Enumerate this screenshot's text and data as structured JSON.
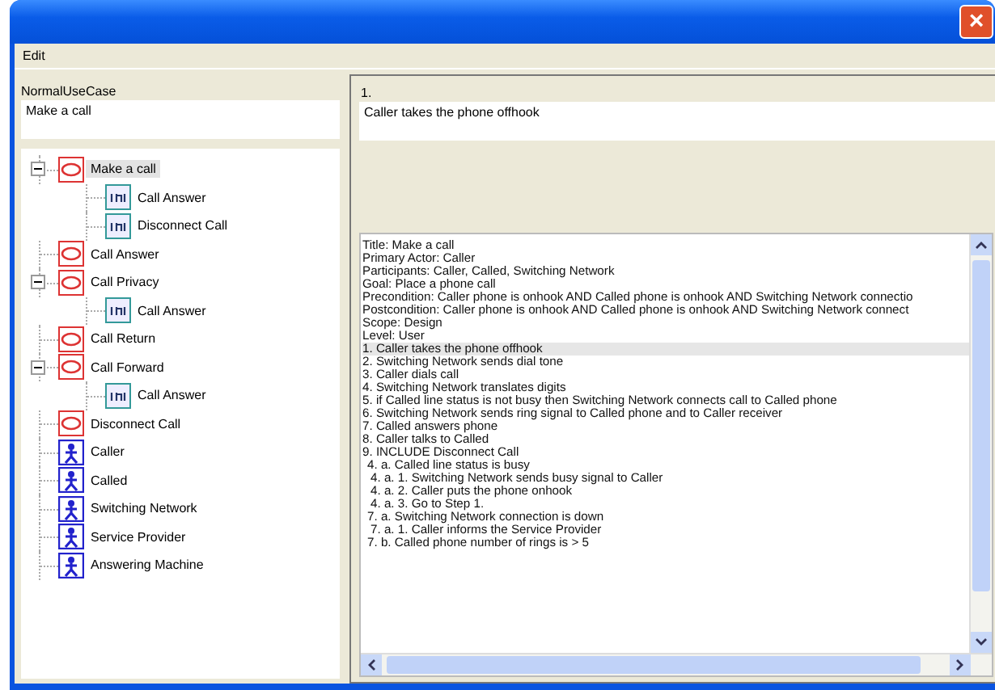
{
  "window": {
    "close": "×"
  },
  "menu": [
    {
      "label": "Edit"
    }
  ],
  "use_case": {
    "label": "NormalUseCase",
    "value": "Make a call"
  },
  "tree": [
    {
      "label": "Make a call",
      "kind": "usecase",
      "selected": true,
      "expanded": true,
      "children": [
        {
          "label": "Call Answer",
          "kind": "include",
          "selected": false
        },
        {
          "label": "Disconnect Call",
          "kind": "include",
          "selected": false
        }
      ]
    },
    {
      "label": "Call Answer",
      "kind": "usecase",
      "selected": false
    },
    {
      "label": "Call Privacy",
      "kind": "usecase",
      "selected": false,
      "expanded": true,
      "children": [
        {
          "label": "Call Answer",
          "kind": "include",
          "selected": false
        }
      ]
    },
    {
      "label": "Call Return",
      "kind": "usecase",
      "selected": false
    },
    {
      "label": "Call Forward",
      "kind": "usecase",
      "selected": false,
      "expanded": true,
      "children": [
        {
          "label": "Call Answer",
          "kind": "include",
          "selected": false
        }
      ]
    },
    {
      "label": "Disconnect Call",
      "kind": "usecase",
      "selected": false
    },
    {
      "label": "Caller",
      "kind": "actor",
      "selected": false
    },
    {
      "label": "Called",
      "kind": "actor",
      "selected": false
    },
    {
      "label": "Switching Network",
      "kind": "actor",
      "selected": false
    },
    {
      "label": "Service Provider",
      "kind": "actor",
      "selected": false
    },
    {
      "label": "Answering Machine",
      "kind": "actor",
      "selected": false
    }
  ],
  "step": {
    "label": "1.",
    "value": "Caller takes the phone offhook"
  },
  "lines": [
    {
      "text": "Title: Make a call",
      "kind": "info",
      "selected": false
    },
    {
      "text": "Primary Actor: Caller",
      "kind": "info",
      "selected": false
    },
    {
      "text": "Participants: Caller, Called, Switching Network",
      "kind": "info",
      "selected": false
    },
    {
      "text": "Goal: Place a phone call",
      "kind": "info",
      "selected": false
    },
    {
      "text": "Precondition: Caller phone is onhook AND Called phone is onhook  AND Switching Network connectio",
      "kind": "info",
      "selected": false
    },
    {
      "text": "Postcondition: Caller phone is onhook AND Called phone is onhook  AND Switching Network connect",
      "kind": "info",
      "selected": false
    },
    {
      "text": "Scope: Design",
      "kind": "info",
      "selected": false
    },
    {
      "text": "Level: User",
      "kind": "info",
      "selected": false
    },
    {
      "text": "1. Caller takes the phone offhook",
      "kind": "step",
      "selected": true
    },
    {
      "text": "2. Switching Network sends dial tone",
      "kind": "step",
      "selected": false
    },
    {
      "text": "3. Caller dials call",
      "kind": "step",
      "selected": false
    },
    {
      "text": "4. Switching Network translates digits",
      "kind": "step",
      "selected": false
    },
    {
      "text": "5. if Called line status is not busy then Switching Network connects call to Called phone",
      "kind": "step",
      "selected": false
    },
    {
      "text": "6. Switching Network sends ring signal to Called phone and to Caller receiver",
      "kind": "step",
      "selected": false
    },
    {
      "text": "7. Called answers phone",
      "kind": "step",
      "selected": false
    },
    {
      "text": "8. Caller talks to Called",
      "kind": "step",
      "selected": false
    },
    {
      "text": "9. INCLUDE Disconnect Call",
      "kind": "step",
      "selected": false
    },
    {
      "text": "4. a. Called line status is busy",
      "kind": "alternative",
      "selected": false
    },
    {
      "text": "4. a. 1. Switching Network sends busy signal to Caller",
      "kind": "substep",
      "selected": false
    },
    {
      "text": "4. a. 2. Caller puts the phone onhook",
      "kind": "substep",
      "selected": false
    },
    {
      "text": "4. a. 3. Go to Step 1.",
      "kind": "substep",
      "selected": false
    },
    {
      "text": "7. a. Switching Network connection is down",
      "kind": "alternative",
      "selected": false
    },
    {
      "text": "7. a. 1. Caller informs the Service Provider",
      "kind": "substep",
      "selected": false
    },
    {
      "text": "7. b. Called phone number of rings is > 5",
      "kind": "alternative",
      "selected": false
    }
  ]
}
